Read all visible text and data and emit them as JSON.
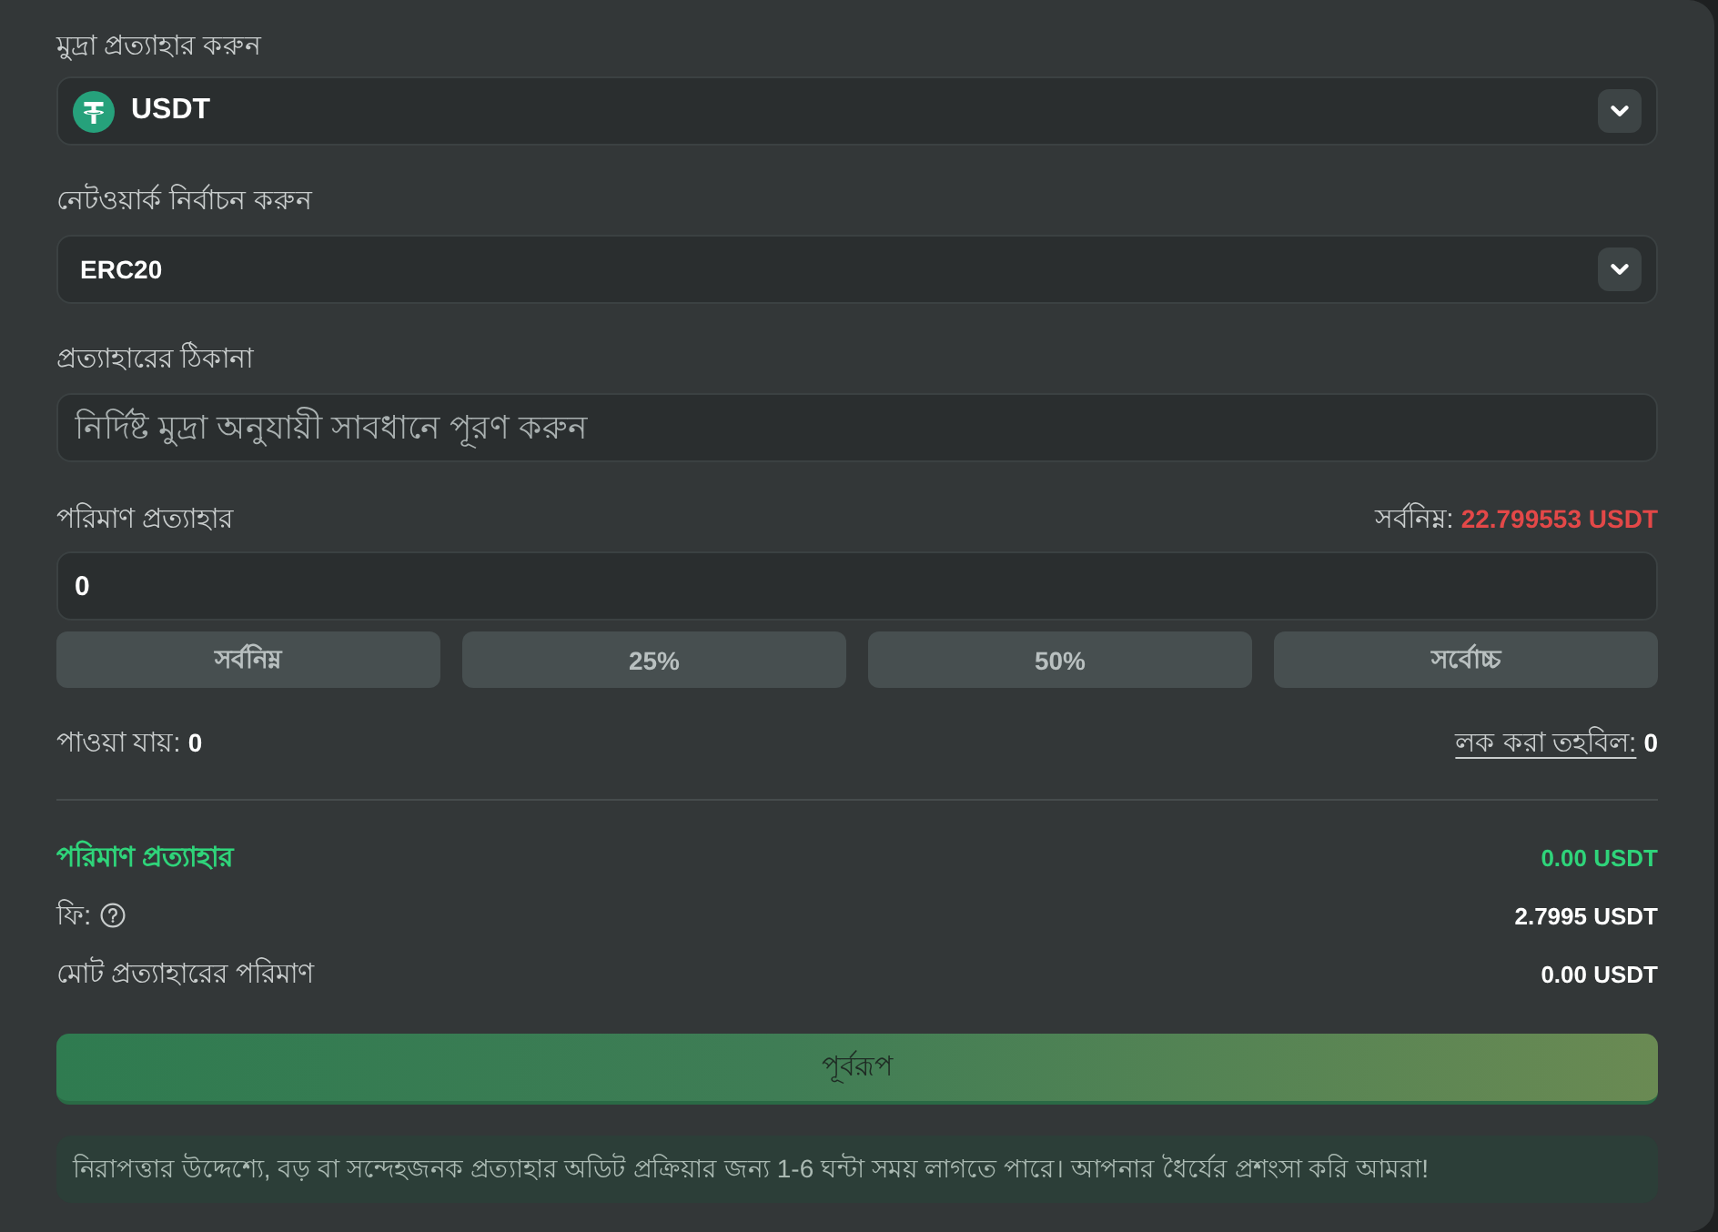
{
  "currency": {
    "label": "মুদ্রা প্রত্যাহার করুন",
    "value": "USDT"
  },
  "network": {
    "label": "নেটওয়ার্ক নির্বাচন করুন",
    "value": "ERC20"
  },
  "address": {
    "label": "প্রত্যাহারের ঠিকানা",
    "placeholder": "নির্দিষ্ট মুদ্রা অনুযায়ী সাবধানে পূরণ করুন"
  },
  "amount": {
    "label": "পরিমাণ প্রত্যাহার",
    "minimum_label": "সর্বনিম্ন:",
    "minimum_value": "22.799553 USDT",
    "value": "0",
    "presets": [
      "সর্বনিম্ন",
      "25%",
      "50%",
      "সর্বোচ্চ"
    ]
  },
  "balances": {
    "available_label": "পাওয়া যায়:",
    "available_value": "0",
    "locked_label": "লক করা তহবিল:",
    "locked_value": "0"
  },
  "summary": [
    {
      "kind": "highlight",
      "label": "পরিমাণ প্রত্যাহার",
      "value": "0.00 USDT"
    },
    {
      "kind": "help",
      "label": "ফি:",
      "value": "2.7995 USDT"
    },
    {
      "kind": "plain",
      "label": "মোট প্রত্যাহারের পরিমাণ",
      "value": "0.00 USDT"
    }
  ],
  "submit_button": "পূর্বরূপ",
  "notice": "নিরাপত্তার উদ্দেশ্যে, বড় বা সন্দেহজনক প্রত্যাহার অডিট প্রক্রিয়ার জন্য 1-6 ঘন্টা সময় লাগতে পারে। আপনার ধৈর্যের প্রশংসা করি আমরা!"
}
